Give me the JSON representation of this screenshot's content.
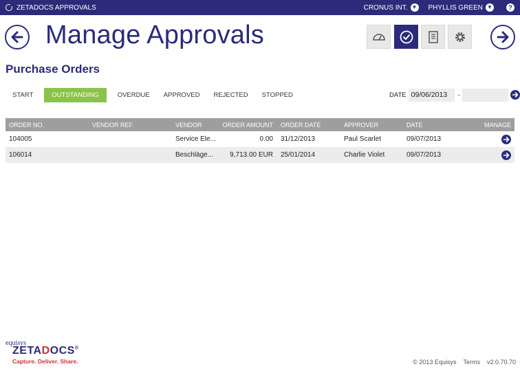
{
  "topbar": {
    "app_name": "ZETADOCS APPROVALS",
    "company": "CRONUS INT.",
    "user": "PHYLLIS GREEN",
    "help": "?"
  },
  "header": {
    "title": "Manage Approvals",
    "section": "Purchase Orders"
  },
  "tabs": [
    {
      "label": "START",
      "active": false
    },
    {
      "label": "OUTSTANDING",
      "active": true
    },
    {
      "label": "OVERDUE",
      "active": false
    },
    {
      "label": "APPROVED",
      "active": false
    },
    {
      "label": "REJECTED",
      "active": false
    },
    {
      "label": "STOPPED",
      "active": false
    }
  ],
  "date_filter": {
    "label": "DATE",
    "from": "09/06/2013",
    "separator": "-",
    "to": ""
  },
  "table": {
    "columns": [
      "ORDER NO.",
      "VENDOR REF.",
      "VENDOR",
      "ORDER AMOUNT",
      "ORDER DATE",
      "APPROVER",
      "DATE",
      "MANAGE"
    ],
    "rows": [
      {
        "order_no": "104005",
        "vendor_ref": "",
        "vendor": "Service Ele...",
        "amount": "0.00",
        "order_date": "31/12/2013",
        "approver": "Paul Scarlet",
        "date": "09/07/2013"
      },
      {
        "order_no": "106014",
        "vendor_ref": "",
        "vendor": "Beschläge...",
        "amount": "9,713.00 EUR",
        "order_date": "25/01/2014",
        "approver": "Charlie Violet",
        "date": "09/07/2013"
      }
    ]
  },
  "footer": {
    "logo_top": "equisys",
    "logo_main_a": "ZETA",
    "logo_main_o": "D",
    "logo_main_b": "OCS",
    "logo_reg": "®",
    "tagline": "Capture. Deliver. Share.",
    "copyright": "© 2013 Equisys",
    "terms": "Terms",
    "version": "v2.0.70.70"
  },
  "colors": {
    "primary": "#2b2b7a",
    "active_tab": "#8bc34a",
    "header_row": "#9e9e9e",
    "alt_row": "#ececec"
  }
}
